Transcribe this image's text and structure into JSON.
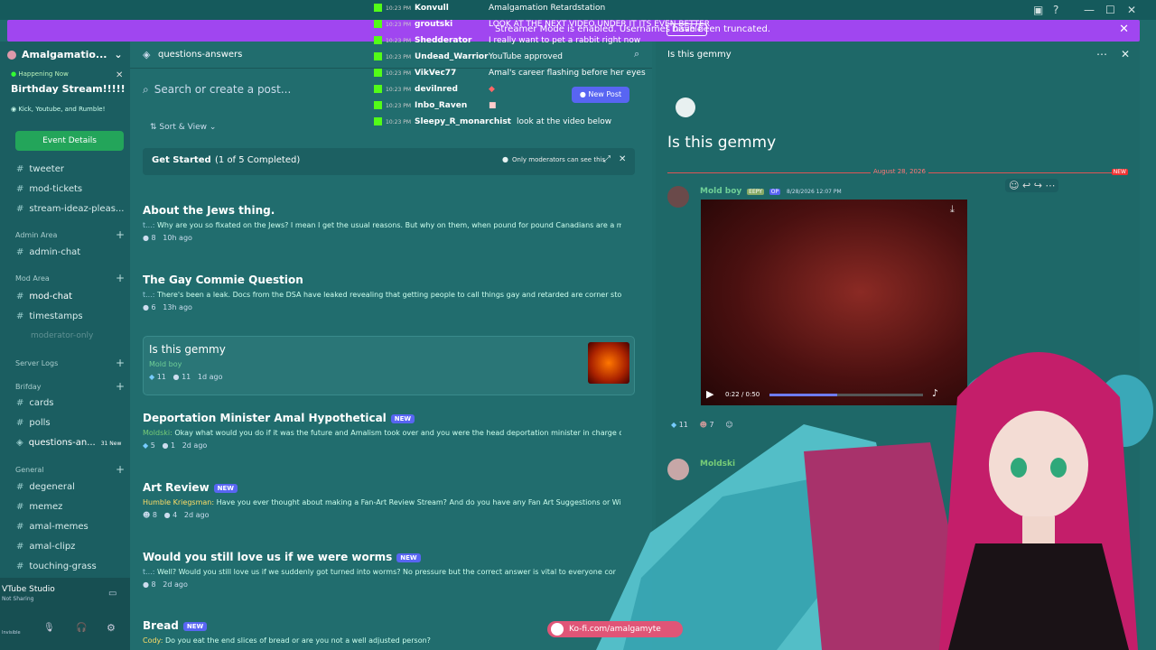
{
  "banner": {
    "text": "Streamer Mode is enabled. Usernames have been truncated.",
    "button": "Disable"
  },
  "server": {
    "name": "Amalgamatio..."
  },
  "event": {
    "now": "Happening Now",
    "title": "Birthday Stream!!!!!",
    "sub": "Kick, Youtube, and Rumble!",
    "button": "Event Details"
  },
  "channels": {
    "c1": "tweeter",
    "c2": "mod-tickets",
    "c3": "stream-ideaz-pleas...",
    "cat_admin": "Admin Area",
    "c4": "admin-chat",
    "cat_mod": "Mod Area",
    "c5": "mod-chat",
    "c6": "timestamps",
    "c7": "moderator-only",
    "cat_logs": "Server Logs",
    "cat_bday": "Brifday",
    "c8": "cards",
    "c9": "polls",
    "c10": "questions-an...",
    "c10_badge": "31 New",
    "cat_general": "General",
    "c11": "degeneral",
    "c12": "memez",
    "c13": "amal-memes",
    "c14": "amal-clipz",
    "c15": "touching-grass"
  },
  "user": {
    "app": "VTube Studio",
    "state": "Not Sharing",
    "status": "Invisible"
  },
  "main": {
    "channel": "questions-answers",
    "search": "Search or create a post...",
    "new_post": "New Post",
    "sort": "Sort & View",
    "get_started": "Get Started",
    "progress": "(1 of 5 Completed)",
    "mod_note": "Only moderators can see this"
  },
  "posts": [
    {
      "title": "About the Jews thing.",
      "author": "t...:",
      "preview": "Why are you so fixated on the Jews? I mean I get the usual reasons. But why on them, when pound for pound Canadians are a much big...",
      "replies": "8",
      "time": "10h ago"
    },
    {
      "title": "The Gay Commie Question",
      "author": "t...:",
      "preview": "There's been a leak. Docs from the DSA have leaked revealing that getting people to call things gay and retarded are corner stones to ...",
      "replies": "6",
      "time": "13h ago"
    },
    {
      "title": "Is this gemmy",
      "author": "Mold boy",
      "preview": "",
      "likes": "11",
      "replies": "11",
      "time": "1d ago"
    },
    {
      "title": "Deportation Minister Amal Hypothetical",
      "author": "Moldski:",
      "preview": "Okay what would you do if it was the future and Amalism took over and you were the head deportation minister in charge of pers...",
      "likes": "5",
      "replies": "1",
      "time": "2d ago",
      "tag": "NEW"
    },
    {
      "title": "Art Review",
      "author": "Humble Kriegsman:",
      "preview": "Have you ever thought about making a Fan-Art Review Stream? And do you have any Fan Art Suggestions or Wishes?(...",
      "likes": "8",
      "replies": "4",
      "time": "2d ago",
      "tag": "NEW"
    },
    {
      "title": "Would you still love us if we were worms",
      "author": "t...:",
      "preview": "Well? Would you still love us if we suddenly got turned into worms? No pressure but the correct answer is vital to everyone cor",
      "replies": "8",
      "time": "2d ago",
      "tag": "NEW"
    },
    {
      "title": "Bread",
      "author": "Cody:",
      "preview": "Do you eat the end slices of bread or are you not a well adjusted person?",
      "tag": "NEW"
    }
  ],
  "chat": [
    {
      "time": "10:23 PM",
      "name": "Konvull",
      "msg": "Amalgamation Retardstation"
    },
    {
      "time": "10:23 PM",
      "name": "groutski",
      "msg": "LOOK AT THE NEXT VIDEO UNDER IT ITS EVEN BETTER"
    },
    {
      "time": "10:23 PM",
      "name": "Shedderator",
      "msg": "I really want to pet a rabbit right now"
    },
    {
      "time": "10:23 PM",
      "name": "Undead_Warrior",
      "msg": "YouTube approved"
    },
    {
      "time": "10:23 PM",
      "name": "VikVec77",
      "msg": "Amal's career flashing before her eyes"
    },
    {
      "time": "10:23 PM",
      "name": "devilnred",
      "msg": ""
    },
    {
      "time": "10:23 PM",
      "name": "Inbo_Raven",
      "msg": ""
    },
    {
      "time": "10:23 PM",
      "name": "Sleepy_R_monarchist",
      "msg": "look at the video below"
    }
  ],
  "thread": {
    "header": "Is this gemmy",
    "title": "Is this gemmy",
    "date_divider": "August 28, 2026",
    "new_label": "NEW",
    "author": "Mold boy",
    "badge": "EEPY",
    "op": "OP",
    "timestamp": "8/28/2026 12:07 PM",
    "video_time": "0:22 / 0:50",
    "likes": "11",
    "reacts": "7",
    "next_author": "Moldski"
  },
  "kofi": {
    "text": "Ko-fi.com/amalgamyte"
  }
}
